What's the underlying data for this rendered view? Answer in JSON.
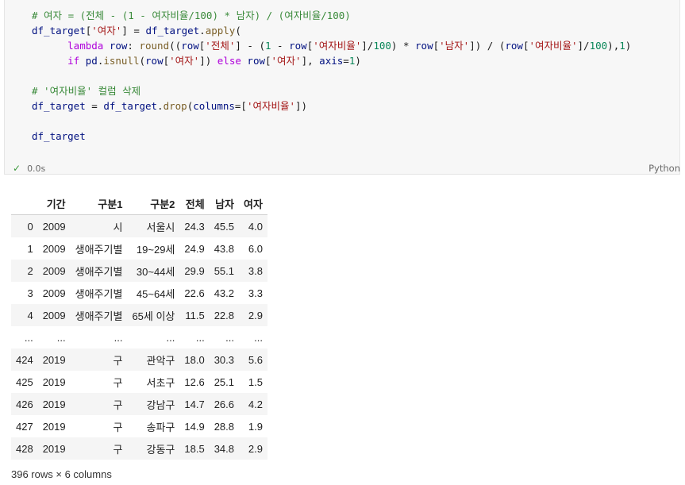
{
  "cell": {
    "code_lines": [
      [
        [
          "cm",
          "# 여자 = (전체 - (1 - 여자비율/100) * 남자) / (여자비율/100)"
        ]
      ],
      [
        [
          "vr",
          "df_target"
        ],
        [
          "",
          "["
        ],
        [
          "st",
          "'여자'"
        ],
        [
          "",
          "] = "
        ],
        [
          "vr",
          "df_target"
        ],
        [
          "",
          "."
        ],
        [
          "fn",
          "apply"
        ],
        [
          "",
          "("
        ]
      ],
      [
        [
          "",
          "      "
        ],
        [
          "kw",
          "lambda"
        ],
        [
          "",
          " "
        ],
        [
          "vr",
          "row"
        ],
        [
          "",
          ": "
        ],
        [
          "fn",
          "round"
        ],
        [
          "",
          "(("
        ],
        [
          "vr",
          "row"
        ],
        [
          "",
          "["
        ],
        [
          "st",
          "'전체'"
        ],
        [
          "",
          "] - ("
        ],
        [
          "nm",
          "1"
        ],
        [
          "",
          " - "
        ],
        [
          "vr",
          "row"
        ],
        [
          "",
          "["
        ],
        [
          "st",
          "'여자비율'"
        ],
        [
          "",
          "]/"
        ],
        [
          "nm",
          "100"
        ],
        [
          "",
          ") * "
        ],
        [
          "vr",
          "row"
        ],
        [
          "",
          "["
        ],
        [
          "st",
          "'남자'"
        ],
        [
          "",
          "]) / ("
        ],
        [
          "vr",
          "row"
        ],
        [
          "",
          "["
        ],
        [
          "st",
          "'여자비율'"
        ],
        [
          "",
          "]/"
        ],
        [
          "nm",
          "100"
        ],
        [
          "",
          "),"
        ],
        [
          "nm",
          "1"
        ],
        [
          "",
          ")"
        ]
      ],
      [
        [
          "",
          "      "
        ],
        [
          "kw",
          "if"
        ],
        [
          "",
          " "
        ],
        [
          "vr",
          "pd"
        ],
        [
          "",
          "."
        ],
        [
          "fn",
          "isnull"
        ],
        [
          "",
          "("
        ],
        [
          "vr",
          "row"
        ],
        [
          "",
          "["
        ],
        [
          "st",
          "'여자'"
        ],
        [
          "",
          "]) "
        ],
        [
          "kw",
          "else"
        ],
        [
          "",
          " "
        ],
        [
          "vr",
          "row"
        ],
        [
          "",
          "["
        ],
        [
          "st",
          "'여자'"
        ],
        [
          "",
          "], "
        ],
        [
          "vr",
          "axis"
        ],
        [
          "",
          "="
        ],
        [
          "nm",
          "1"
        ],
        [
          "",
          ")"
        ]
      ],
      [],
      [
        [
          "cm",
          "# '여자비율' 컬럼 삭제"
        ]
      ],
      [
        [
          "vr",
          "df_target"
        ],
        [
          "",
          " = "
        ],
        [
          "vr",
          "df_target"
        ],
        [
          "",
          "."
        ],
        [
          "fn",
          "drop"
        ],
        [
          "",
          "("
        ],
        [
          "vr",
          "columns"
        ],
        [
          "",
          "=["
        ],
        [
          "st",
          "'여자비율'"
        ],
        [
          "",
          "])"
        ]
      ],
      [],
      [
        [
          "vr",
          "df_target"
        ]
      ]
    ],
    "exec_time": "0.0s",
    "language": "Python"
  },
  "table": {
    "columns": [
      "",
      "기간",
      "구분1",
      "구분2",
      "전체",
      "남자",
      "여자"
    ],
    "rows": [
      [
        "0",
        "2009",
        "시",
        "서울시",
        "24.3",
        "45.5",
        "4.0"
      ],
      [
        "1",
        "2009",
        "생애주기별",
        "19~29세",
        "24.9",
        "43.8",
        "6.0"
      ],
      [
        "2",
        "2009",
        "생애주기별",
        "30~44세",
        "29.9",
        "55.1",
        "3.8"
      ],
      [
        "3",
        "2009",
        "생애주기별",
        "45~64세",
        "22.6",
        "43.2",
        "3.3"
      ],
      [
        "4",
        "2009",
        "생애주기별",
        "65세 이상",
        "11.5",
        "22.8",
        "2.9"
      ],
      [
        "...",
        "...",
        "...",
        "...",
        "...",
        "...",
        "..."
      ],
      [
        "424",
        "2019",
        "구",
        "관악구",
        "18.0",
        "30.3",
        "5.6"
      ],
      [
        "425",
        "2019",
        "구",
        "서초구",
        "12.6",
        "25.1",
        "1.5"
      ],
      [
        "426",
        "2019",
        "구",
        "강남구",
        "14.7",
        "26.6",
        "4.2"
      ],
      [
        "427",
        "2019",
        "구",
        "송파구",
        "14.9",
        "28.8",
        "1.9"
      ],
      [
        "428",
        "2019",
        "구",
        "강동구",
        "18.5",
        "34.8",
        "2.9"
      ]
    ],
    "footer": "396 rows × 6 columns"
  }
}
